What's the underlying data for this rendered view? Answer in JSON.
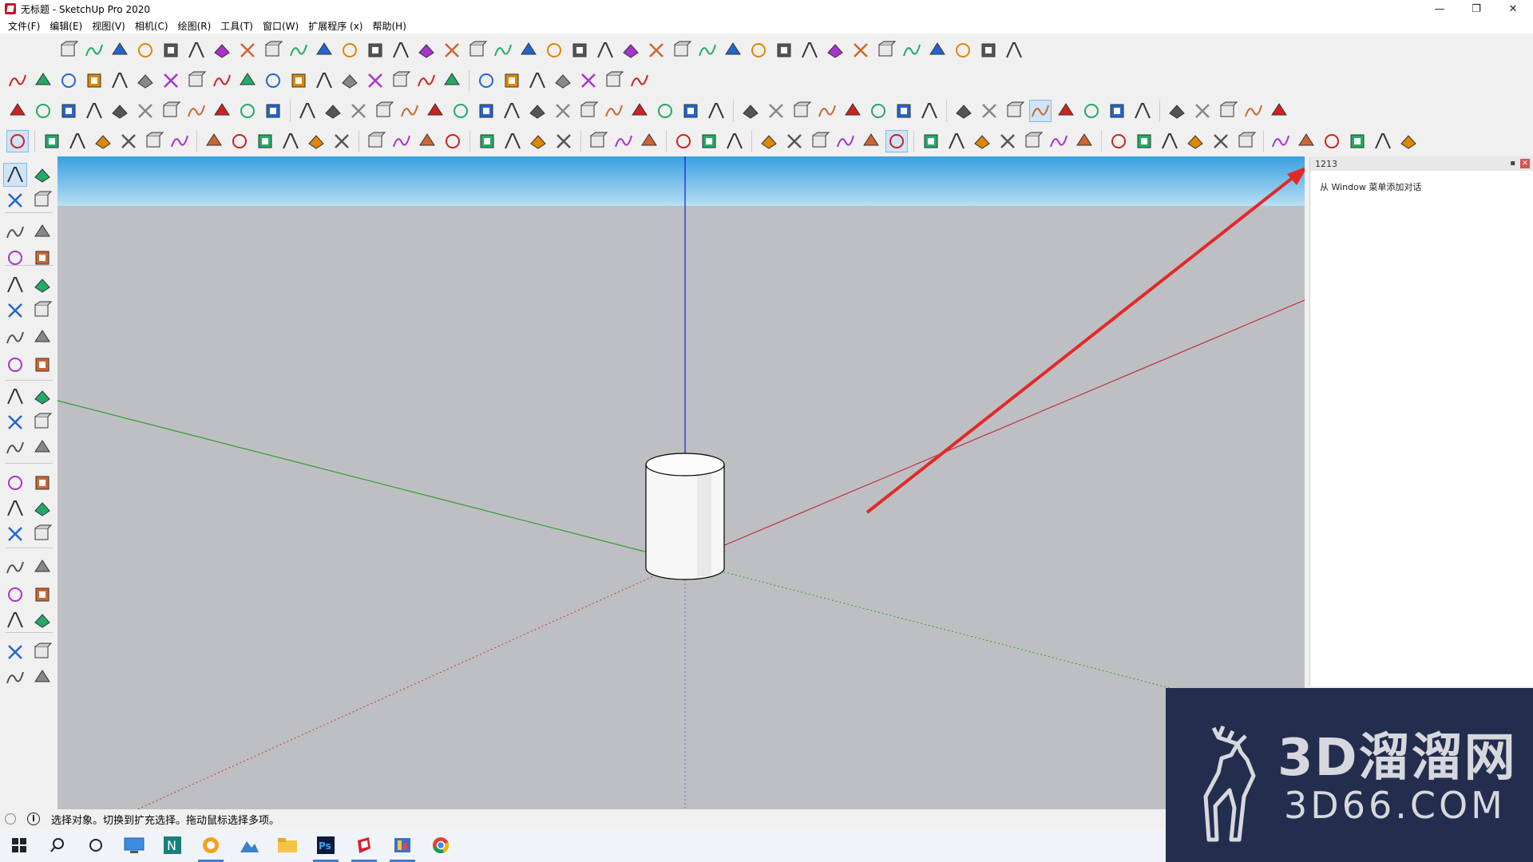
{
  "window": {
    "title": "无标题 - SketchUp Pro 2020",
    "controls": {
      "minimize": "—",
      "restore": "❐",
      "close": "✕"
    }
  },
  "menu": [
    "文件(F)",
    "编辑(E)",
    "视图(V)",
    "相机(C)",
    "绘图(R)",
    "工具(T)",
    "窗口(W)",
    "扩展程序 (x)",
    "帮助(H)"
  ],
  "panel": {
    "title": "1213",
    "message": "从 Window 菜单添加对话"
  },
  "status": {
    "text": "选择对象。切换到扩充选择。拖动鼠标选择多项。"
  },
  "watermark": {
    "cn": "3D溜溜网",
    "en": "3D66.COM"
  },
  "colors": {
    "accent": "#e32828",
    "axis_red": "#c0304a",
    "axis_green": "#2e9e2e",
    "axis_blue": "#1a1ad0",
    "sky_top": "#3a9fe0",
    "ground": "#bebfc3",
    "watermark_bg": "#232d4d"
  },
  "toolbar_icons": {
    "row1": [
      "sandbox-icon",
      "curve-icon",
      "push-icon",
      "cut-icon",
      "shape-icon",
      "offset-icon",
      "bend-icon",
      "box-icon"
    ],
    "left": [
      "select-icon",
      "component-icon",
      "paint-icon",
      "eraser-icon",
      "pencil-icon",
      "freehand-icon"
    ]
  }
}
